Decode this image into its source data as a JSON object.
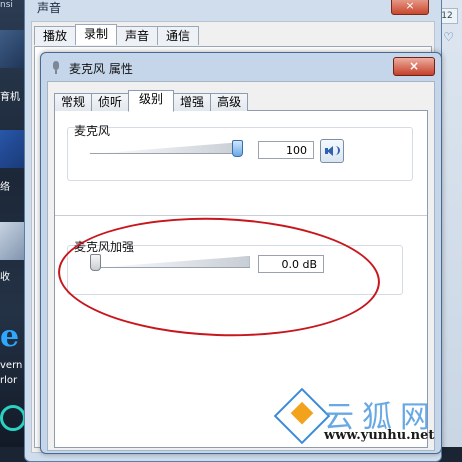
{
  "desktop": {
    "top_text": "nsi",
    "labels": [
      "育机",
      "络",
      "收",
      "vern",
      "rlor"
    ]
  },
  "right_edge": {
    "tab_text": "12"
  },
  "back_window": {
    "title": "声音",
    "close_label": "×",
    "tabs": [
      "播放",
      "录制",
      "声音",
      "通信"
    ],
    "active_tab": "录制"
  },
  "dialog": {
    "title": "麦克风 属性",
    "close_label": "×",
    "tabs": [
      {
        "label": "常规",
        "active": false
      },
      {
        "label": "侦听",
        "active": false
      },
      {
        "label": "级别",
        "active": true
      },
      {
        "label": "增强",
        "active": false
      },
      {
        "label": "高级",
        "active": false
      }
    ],
    "microphone": {
      "label": "麦克风",
      "value_text": "100",
      "level": 100,
      "mute_icon": "speaker-icon"
    },
    "boost": {
      "label": "麦克风加强",
      "value_text": "0.0 dB",
      "level": 0
    }
  },
  "annotation": {
    "color": "#c8161d"
  },
  "watermark": {
    "text_cn": "云狐网",
    "url": "www.yunhu.net"
  },
  "colors": {
    "accent": "#3c6fa8",
    "title_bar": "#c5d6ea",
    "close_button": "#c4402a"
  }
}
